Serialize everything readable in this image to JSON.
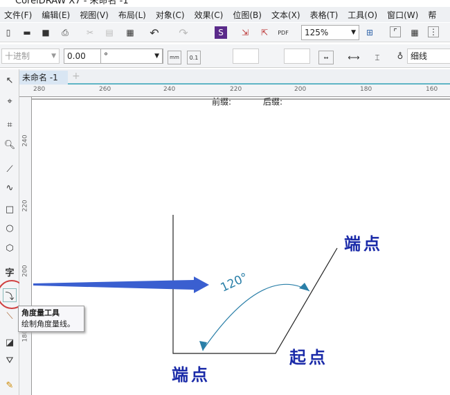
{
  "title": "CorelDRAW X7 - 未命名 -1",
  "menu": [
    "文件(F)",
    "编辑(E)",
    "视图(V)",
    "布局(L)",
    "对象(C)",
    "效果(C)",
    "位图(B)",
    "文本(X)",
    "表格(T)",
    "工具(O)",
    "窗口(W)",
    "帮"
  ],
  "toolbar": {
    "zoom": "125%"
  },
  "propbar": {
    "style": "十进制",
    "precision": "0.00",
    "unit": "°",
    "prefix_label": "前缀:",
    "suffix_label": "后缀:",
    "outline": "细线"
  },
  "tabs": {
    "doc": "未命名 -1",
    "add": "+"
  },
  "ruler": {
    "h": [
      "280",
      "260",
      "240",
      "220",
      "200",
      "180",
      "160"
    ],
    "v": [
      "240",
      "220",
      "200",
      "180"
    ]
  },
  "tooltip": {
    "title": "角度量工具",
    "desc": "绘制角度量线。"
  },
  "canvas": {
    "angle": "120°",
    "end1": "端点",
    "start": "起点",
    "end2": "端点"
  },
  "colors": {
    "label": "#1a2aa8",
    "arrow": "#3a5fd0",
    "dim": "#2a7fa8",
    "highlight": "#d04040"
  }
}
